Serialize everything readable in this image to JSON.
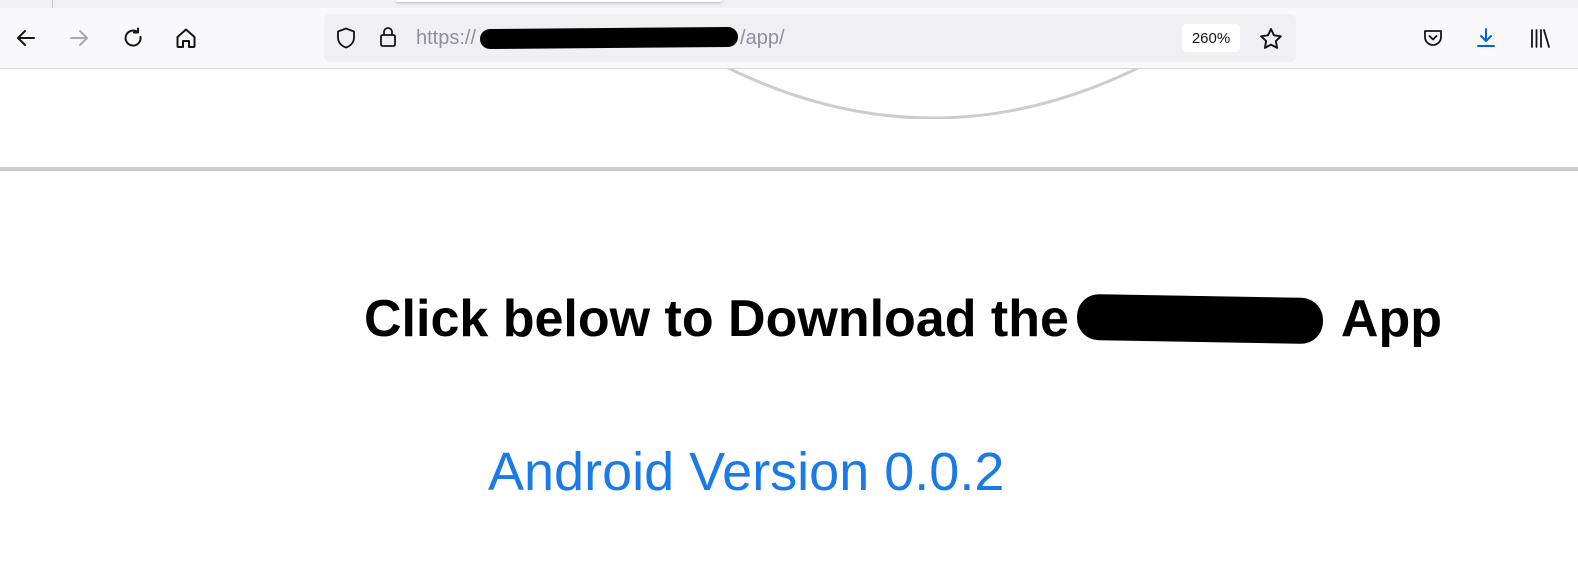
{
  "browser": {
    "url_prefix": "https://",
    "url_path": "/app/",
    "zoom": "260%",
    "icons": [
      "back-arrow-icon",
      "forward-arrow-icon",
      "reload-icon",
      "home-icon",
      "shield-icon",
      "lock-icon",
      "star-icon",
      "pocket-icon",
      "download-icon",
      "library-icon"
    ]
  },
  "page": {
    "heading_before": "Click below to Download the",
    "heading_after": "App",
    "download_link": "Android Version 0.0.2"
  },
  "colors": {
    "link": "#1a7be6",
    "download_icon": "#0061e0"
  }
}
